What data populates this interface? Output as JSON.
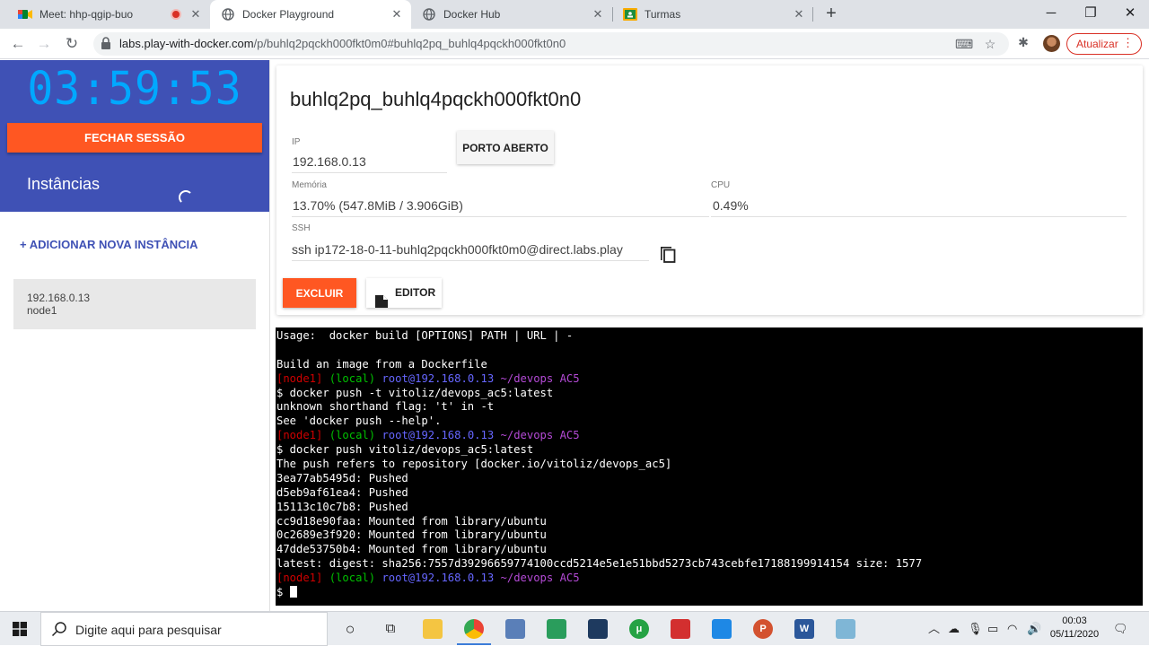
{
  "browser": {
    "tabs": [
      {
        "title": "Meet: hhp-qgip-buo",
        "active": false
      },
      {
        "title": "Docker Playground",
        "active": true
      },
      {
        "title": "Docker Hub",
        "active": false
      },
      {
        "title": "Turmas",
        "active": false
      }
    ],
    "url_host": "labs.play-with-docker.com",
    "url_path": "/p/buhlq2pqckh000fkt0m0#buhlq2pq_buhlq4pqckh000fkt0n0",
    "update_label": "Atualizar"
  },
  "sidebar": {
    "timer": "03:59:53",
    "close_session_label": "FECHAR SESSÃO",
    "instances_title": "Instâncias",
    "add_instance_label": "+ ADICIONAR NOVA INSTÂNCIA",
    "instances": [
      {
        "ip": "192.168.0.13",
        "name": "node1"
      }
    ]
  },
  "instance": {
    "hostname": "buhlq2pq_buhlq4pqckh000fkt0n0",
    "ip_label": "IP",
    "ip_value": "192.168.0.13",
    "open_port_label": "PORTO ABERTO",
    "memory_label": "Memória",
    "memory_value": "13.70% (547.8MiB / 3.906GiB)",
    "cpu_label": "CPU",
    "cpu_value": "0.49%",
    "ssh_label": "SSH",
    "ssh_value": "ssh ip172-18-0-11-buhlq2pqckh000fkt0m0@direct.labs.play",
    "delete_label": "EXCLUIR",
    "editor_label": "EDITOR"
  },
  "terminal": {
    "lines": [
      {
        "type": "text",
        "text": "Usage:  docker build [OPTIONS] PATH | URL | -"
      },
      {
        "type": "text",
        "text": ""
      },
      {
        "type": "text",
        "text": "Build an image from a Dockerfile"
      },
      {
        "type": "prompt",
        "node": "[node1]",
        "local": "(local)",
        "user": "root@192.168.0.13",
        "dir": "~/devops AC5"
      },
      {
        "type": "text",
        "text": "$ docker push -t vitoliz/devops_ac5:latest"
      },
      {
        "type": "text",
        "text": "unknown shorthand flag: 't' in -t"
      },
      {
        "type": "text",
        "text": "See 'docker push --help'."
      },
      {
        "type": "prompt",
        "node": "[node1]",
        "local": "(local)",
        "user": "root@192.168.0.13",
        "dir": "~/devops AC5"
      },
      {
        "type": "text",
        "text": "$ docker push vitoliz/devops_ac5:latest"
      },
      {
        "type": "text",
        "text": "The push refers to repository [docker.io/vitoliz/devops_ac5]"
      },
      {
        "type": "text",
        "text": "3ea77ab5495d: Pushed"
      },
      {
        "type": "text",
        "text": "d5eb9af61ea4: Pushed"
      },
      {
        "type": "text",
        "text": "15113c10c7b8: Pushed"
      },
      {
        "type": "text",
        "text": "cc9d18e90faa: Mounted from library/ubuntu"
      },
      {
        "type": "text",
        "text": "0c2689e3f920: Mounted from library/ubuntu"
      },
      {
        "type": "text",
        "text": "47dde53750b4: Mounted from library/ubuntu"
      },
      {
        "type": "text",
        "text": "latest: digest: sha256:7557d39296659774100ccd5214e5e1e51bbd5273cb743cebfe17188199914154 size: 1577"
      },
      {
        "type": "prompt",
        "node": "[node1]",
        "local": "(local)",
        "user": "root@192.168.0.13",
        "dir": "~/devops AC5"
      },
      {
        "type": "cursor",
        "text": "$ "
      }
    ]
  },
  "taskbar": {
    "search_placeholder": "Digite aqui para pesquisar",
    "time": "00:03",
    "date": "05/11/2020"
  }
}
